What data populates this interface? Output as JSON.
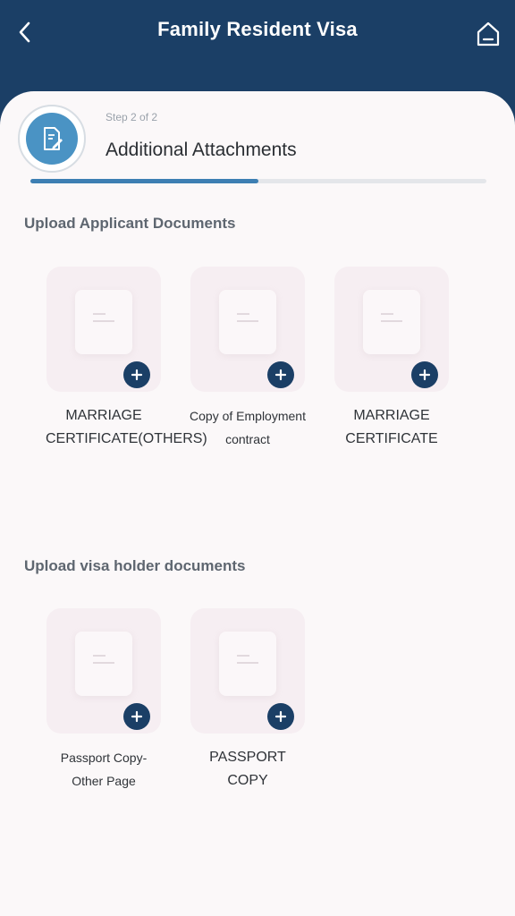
{
  "header": {
    "title": "Family Resident Visa"
  },
  "step": {
    "label": "Step 2 of 2",
    "title": "Additional Attachments",
    "progress_fraction": 0.5
  },
  "applicant_section": {
    "title": "Upload Applicant Documents",
    "documents": [
      {
        "label": "MARRIAGE CERTIFICATE(OTHERS)"
      },
      {
        "label": "Copy of Employment contract"
      },
      {
        "label": "MARRIAGE CERTIFICATE"
      }
    ]
  },
  "visa_holder_section": {
    "title": "Upload visa holder documents",
    "documents": [
      {
        "label": "Passport Copy-Other Page"
      },
      {
        "label": "PASSPORT COPY"
      }
    ]
  },
  "colors": {
    "header_bg": "#1b3f66",
    "accent": "#3d7fb3",
    "card_bg": "#fbf8f9"
  }
}
